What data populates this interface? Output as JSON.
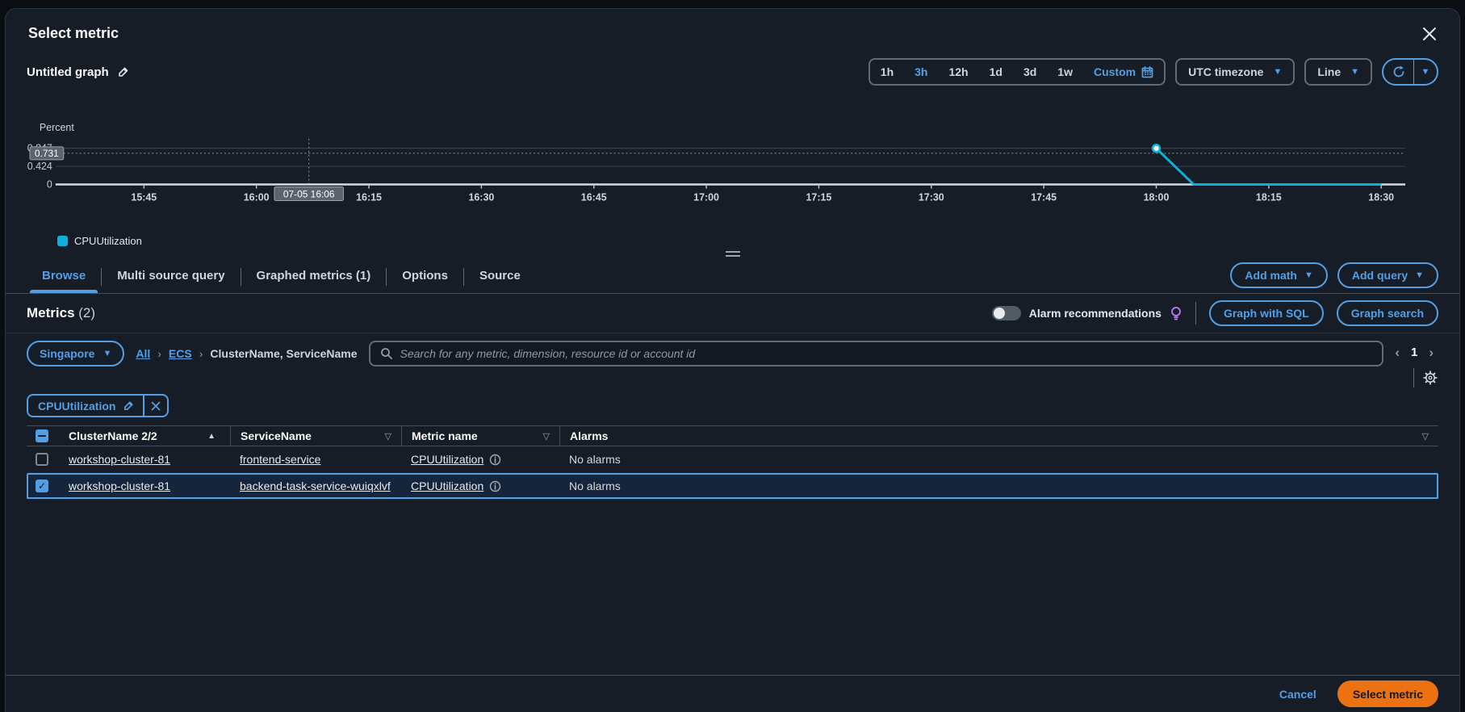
{
  "modal": {
    "title": "Select metric"
  },
  "icons": {
    "close": "✕",
    "caret_down": "▼",
    "sort_asc": "▲",
    "sort_desc_outline": "▽",
    "chevron_left": "‹",
    "chevron_right": "›",
    "breadcrumb_sep": "›",
    "checkbox_check": "✓"
  },
  "graph_toolbar": {
    "graph_name": "Untitled graph",
    "time_ranges": [
      "1h",
      "3h",
      "12h",
      "1d",
      "3d",
      "1w"
    ],
    "active_range": "3h",
    "custom_label": "Custom",
    "timezone_label": "UTC timezone",
    "chart_type_label": "Line"
  },
  "chart_data": {
    "type": "line",
    "ylabel": "Percent",
    "yticks": [
      "0",
      "0.424",
      "0.847"
    ],
    "ytick_values": [
      0,
      0.424,
      0.847
    ],
    "ylim": [
      0,
      0.9
    ],
    "xticks": [
      "15:45",
      "16:00",
      "16:15",
      "16:30",
      "16:45",
      "17:00",
      "17:15",
      "17:30",
      "17:45",
      "18:00",
      "18:15",
      "18:30"
    ],
    "xtick_minutes": [
      12,
      27,
      42,
      57,
      72,
      87,
      102,
      117,
      132,
      147,
      162,
      177
    ],
    "x_domain_minutes": [
      0,
      181
    ],
    "grid": "horizontal",
    "series": [
      {
        "name": "CPUUtilization",
        "color": "#0eb0d8",
        "points_minutes": [
          [
            147,
            0.847
          ],
          [
            152,
            0
          ],
          [
            177,
            0
          ]
        ],
        "marker_point": [
          147,
          0.847
        ]
      }
    ],
    "crosshair": {
      "time_label": "07-05 16:06",
      "time_minute": 34,
      "value_label": "0.731",
      "value": 0.731
    },
    "legend": [
      {
        "label": "CPUUtilization",
        "color": "#0eb0d8"
      }
    ],
    "legend_position": "bottom-left"
  },
  "tabs": [
    {
      "label": "Browse",
      "active": true
    },
    {
      "label": "Multi source query",
      "active": false
    },
    {
      "label": "Graphed metrics (1)",
      "active": false
    },
    {
      "label": "Options",
      "active": false
    },
    {
      "label": "Source",
      "active": false
    }
  ],
  "tab_actions": {
    "add_math": "Add math",
    "add_query": "Add query"
  },
  "metrics_header": {
    "title": "Metrics",
    "count": "(2)",
    "alarm_toggle_label": "Alarm recommendations",
    "graph_with_sql": "Graph with SQL",
    "graph_search": "Graph search"
  },
  "filter_bar": {
    "region": "Singapore",
    "breadcrumb_all": "All",
    "breadcrumb_ecs": "ECS",
    "breadcrumb_current": "ClusterName, ServiceName",
    "search_placeholder": "Search for any metric, dimension, resource id or account id",
    "page_number": "1"
  },
  "filter_tag": {
    "label": "CPUUtilization"
  },
  "table": {
    "columns": {
      "cluster": "ClusterName 2/2",
      "service": "ServiceName",
      "metric": "Metric name",
      "alarms": "Alarms"
    },
    "rows": [
      {
        "cluster": "workshop-cluster-81",
        "service": "frontend-service",
        "metric": "CPUUtilization",
        "alarms": "No alarms",
        "selected": false
      },
      {
        "cluster": "workshop-cluster-81",
        "service": "backend-task-service-wuiqxlvf",
        "metric": "CPUUtilization",
        "alarms": "No alarms",
        "selected": true
      }
    ]
  },
  "footer": {
    "cancel": "Cancel",
    "submit": "Select metric"
  },
  "colors": {
    "accent_blue": "#539fe5",
    "line_teal": "#0eb0d8",
    "primary_orange": "#ec7211",
    "alarm_bulb_purple": "#bf80ff"
  }
}
